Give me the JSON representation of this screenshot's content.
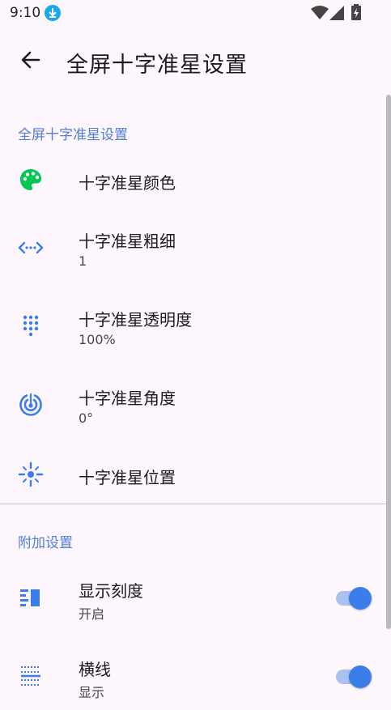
{
  "status_bar": {
    "time": "9:10"
  },
  "app_bar": {
    "title": "全屏十字准星设置"
  },
  "sections": {
    "crosshair": {
      "header": "全屏十字准星设置",
      "items": [
        {
          "title": "十字准星颜色",
          "icon": "palette-icon"
        },
        {
          "title": "十字准星粗细",
          "summary": "1",
          "icon": "thickness-arrows-icon"
        },
        {
          "title": "十字准星透明度",
          "summary": "100%",
          "icon": "dot-grid-icon"
        },
        {
          "title": "十字准星角度",
          "summary": "0°",
          "icon": "target-icon"
        },
        {
          "title": "十字准星位置",
          "icon": "position-crosshair-icon"
        }
      ]
    },
    "extra": {
      "header": "附加设置",
      "items": [
        {
          "title": "显示刻度",
          "summary": "开启",
          "icon": "scale-icon",
          "switch_on": true
        },
        {
          "title": "横线",
          "summary": "显示",
          "icon": "horizontal-line-icon",
          "switch_on": true
        }
      ]
    }
  },
  "colors": {
    "accent": "#3c7ee9",
    "section_header": "#4f7fd6",
    "palette_green": "#00c853",
    "background": "#fdf7fd"
  }
}
